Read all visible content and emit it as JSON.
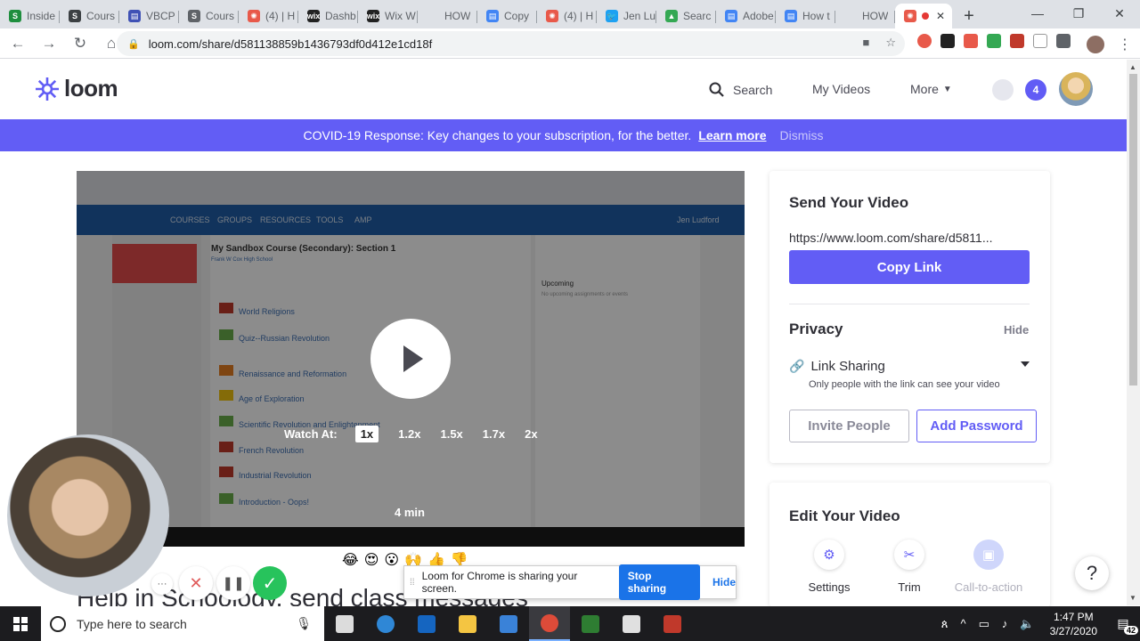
{
  "browser": {
    "tabs": [
      {
        "title": "Inside",
        "color": "#1e8e3e",
        "glyph": "S"
      },
      {
        "title": "Cours",
        "color": "#3c4043",
        "glyph": "S"
      },
      {
        "title": "VBCP",
        "color": "#3f51b5",
        "glyph": "▤"
      },
      {
        "title": "Cours",
        "color": "#5f6368",
        "glyph": "S"
      },
      {
        "title": "(4) | H",
        "color": "#e8594a",
        "glyph": "✺"
      },
      {
        "title": "Dashb",
        "color": "#222",
        "glyph": "wix"
      },
      {
        "title": "Wix W",
        "color": "#222",
        "glyph": "wix"
      },
      {
        "title": "HOW",
        "color": "#dee1e6",
        "glyph": ""
      },
      {
        "title": "Copy",
        "color": "#4285f4",
        "glyph": "▤"
      },
      {
        "title": "(4) | H",
        "color": "#e8594a",
        "glyph": "✺"
      },
      {
        "title": "Jen Lu",
        "color": "#1da1f2",
        "glyph": "🐦"
      },
      {
        "title": "Searc",
        "color": "#34a853",
        "glyph": "▲"
      },
      {
        "title": "Adobe",
        "color": "#4285f4",
        "glyph": "▤"
      },
      {
        "title": "How t",
        "color": "#4285f4",
        "glyph": "▤"
      },
      {
        "title": "HOW",
        "color": "#dee1e6",
        "glyph": ""
      }
    ],
    "active_tab_glyph": "✺",
    "active_tab_close": "✕",
    "new_tab": "+",
    "window_controls": {
      "minimize": "—",
      "maximize": "❐",
      "close": "✕"
    },
    "nav": {
      "back": "←",
      "forward": "→",
      "reload": "↻",
      "home": "⌂"
    },
    "url": "loom.com/share/d581138859b1436793df0d412e1cd18f",
    "lock_icon": "🔒",
    "omnibox_icons": {
      "camera": "■",
      "star": "☆"
    }
  },
  "loom": {
    "logo_text": "loom",
    "brand_color": "#625df5",
    "nav": {
      "search": "Search",
      "my_videos": "My Videos",
      "more": "More"
    },
    "notification_count": "4",
    "banner": {
      "text": "COVID-19 Response: Key changes to your subscription, for the better.",
      "learn_more": "Learn more",
      "dismiss": "Dismiss"
    },
    "player": {
      "watch_at_label": "Watch At:",
      "speeds": [
        "1x",
        "1.2x",
        "1.5x",
        "1.7x",
        "2x"
      ],
      "selected_speed": "1x",
      "duration": "4 min",
      "reactions": [
        "😂",
        "😍",
        "😮",
        "🙌",
        "👍",
        "👎"
      ]
    },
    "video_thumbnail": {
      "course_title": "My Sandbox Course (Secondary): Section 1",
      "school": "Frank W Cox High School",
      "nav_items": [
        "COURSES",
        "GROUPS",
        "RESOURCES",
        "TOOLS",
        "AMP"
      ],
      "user": "Jen Ludford",
      "materials": [
        "World Religions",
        "Quiz--Russian Revolution",
        "Renaissance and Reformation",
        "Age of Exploration",
        "Scientific Revolution and Enlightenment",
        "French Revolution",
        "Industrial Revolution",
        "Introduction - Oops!"
      ],
      "upcoming": "Upcoming",
      "no_upcoming": "No upcoming assignments or events"
    },
    "send_card": {
      "title": "Send Your Video",
      "share_url": "https://www.loom.com/share/d5811...",
      "copy_link": "Copy Link",
      "privacy_title": "Privacy",
      "privacy_hide": "Hide",
      "link_sharing": "Link Sharing",
      "link_desc": "Only people with the link can see your video",
      "invite": "Invite People",
      "add_password": "Add Password"
    },
    "edit_card": {
      "title": "Edit Your Video",
      "tools": [
        {
          "label": "Settings",
          "icon": "⚙"
        },
        {
          "label": "Trim",
          "icon": "✂"
        },
        {
          "label": "Call-to-action",
          "icon": "▣"
        }
      ]
    },
    "page_title_partial": "Help in Schoology, send class messages",
    "help_icon": "?"
  },
  "recorder": {
    "more_icon": "···",
    "cancel_icon": "✕",
    "pause_icon": "❚❚",
    "done_icon": "✓",
    "share_text": "Loom for Chrome is sharing your screen.",
    "stop_sharing": "Stop sharing",
    "hide": "Hide"
  },
  "taskbar": {
    "search_placeholder": "Type here to search",
    "apps": [
      {
        "name": "task-view",
        "color": "#dcdcdc"
      },
      {
        "name": "edge",
        "color": "#2f87d6"
      },
      {
        "name": "outlook",
        "color": "#1565c0"
      },
      {
        "name": "file-explorer",
        "color": "#f4c542"
      },
      {
        "name": "store",
        "color": "#3a82d8"
      },
      {
        "name": "chrome",
        "color": "#dd4b39"
      },
      {
        "name": "app-green",
        "color": "#2e7d32"
      },
      {
        "name": "photos",
        "color": "#e0e0e0"
      },
      {
        "name": "snipping",
        "color": "#c0392b"
      }
    ],
    "time": "1:47 PM",
    "date": "3/27/2020",
    "notification_count": "42"
  }
}
